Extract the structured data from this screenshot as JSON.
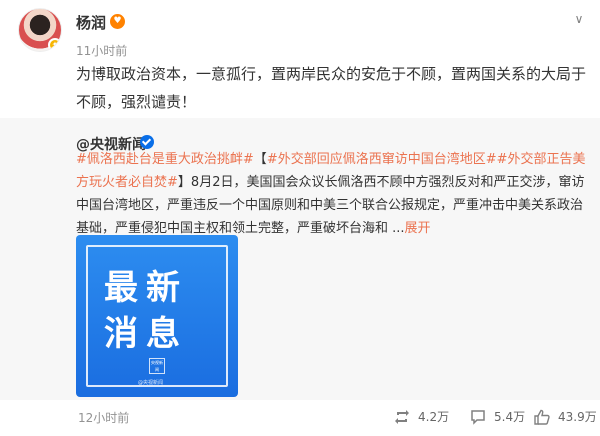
{
  "post": {
    "author": "杨润",
    "author_badge_icon": "vip-heart-icon",
    "time": "11小时前",
    "text": "为博取政治资本，一意孤行，置两岸民众的安危于不顾，置两国关系的大局于不顾，强烈谴责！",
    "more_icon": "chevron-down-icon"
  },
  "repost": {
    "author": "@央视新闻",
    "verified_icon": "verified-icon",
    "tags": [
      "#佩洛西赴台是重大政治挑衅#",
      "#外交部回应佩洛西窜访中国台湾地区#",
      "#外交部正告美方玩火者必自焚#"
    ],
    "open_bracket": "【",
    "close_bracket": "】",
    "body": "8月2日，美国国会众议长佩洛西不顾中方强烈反对和严正交涉，窜访中国台湾地区，严重违反一个中国原则和中美三个联合公报规定，严重冲击中美关系政治基础，严重侵犯中国主权和领土完整，严重破坏台海和  ...",
    "expand_label": "展开",
    "image": {
      "line1": "最新",
      "line2": "消息",
      "logo_text": "央视新闻",
      "watermark": "@央视新闻"
    },
    "time": "12小时前"
  },
  "actions": {
    "repost_count": "4.2万",
    "comment_count": "5.4万",
    "like_count": "43.9万"
  },
  "colors": {
    "accent": "#eb7350",
    "verified": "#0a6fe8",
    "card_bg": "#f7f7f7"
  }
}
